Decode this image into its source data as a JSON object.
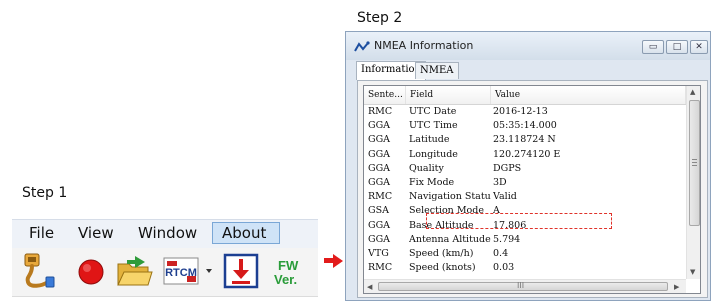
{
  "steps": {
    "step1": "Step 1",
    "step2": "Step 2"
  },
  "menu": {
    "file": "File",
    "view": "View",
    "window": "Window",
    "about": "About"
  },
  "toolbar": {
    "rtcm_label": "RTCM",
    "fw_line1": "FW",
    "fw_line2": "Ver."
  },
  "colors": {
    "accent_red": "#e21b1b",
    "menu_highlight": "#cfe3f7",
    "fw_green": "#2a9c3a"
  },
  "nmea_window": {
    "title": "NMEA Information",
    "tabs": [
      "Information",
      "NMEA"
    ],
    "columns": [
      "Sente...",
      "Field",
      "Value"
    ],
    "rows": [
      [
        "RMC",
        "UTC Date",
        "2016-12-13"
      ],
      [
        "GGA",
        "UTC Time",
        "05:35:14.000"
      ],
      [
        "GGA",
        "Latitude",
        "23.118724 N"
      ],
      [
        "GGA",
        "Longitude",
        "120.274120 E"
      ],
      [
        "GGA",
        "Quality",
        "DGPS"
      ],
      [
        "GGA",
        "Fix Mode",
        "3D"
      ],
      [
        "RMC",
        "Navigation Status",
        "Valid"
      ],
      [
        "GSA",
        "Selection Mode",
        "A"
      ],
      [
        "GGA",
        "Base Altitude",
        "17.806"
      ],
      [
        "GGA",
        "Antenna Altitude",
        "5.794"
      ],
      [
        "VTG",
        "Speed (km/h)",
        "0.4"
      ],
      [
        "RMC",
        "Speed (knots)",
        "0.03"
      ]
    ],
    "hscroll_label": "III"
  }
}
